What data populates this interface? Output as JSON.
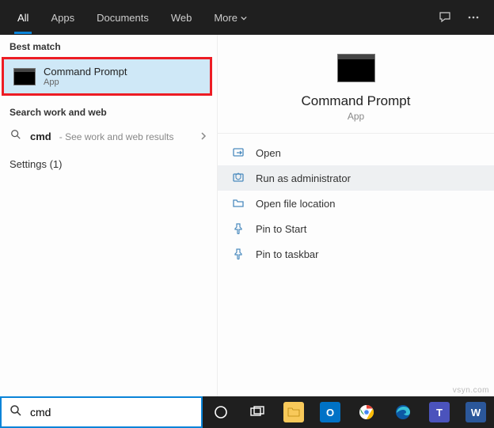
{
  "topbar": {
    "tabs": [
      {
        "label": "All",
        "active": true
      },
      {
        "label": "Apps",
        "active": false
      },
      {
        "label": "Documents",
        "active": false
      },
      {
        "label": "Web",
        "active": false
      },
      {
        "label": "More",
        "active": false,
        "dropdown": true
      }
    ]
  },
  "left": {
    "best_match_label": "Best match",
    "best_match": {
      "title": "Command Prompt",
      "subtitle": "App"
    },
    "search_web_label": "Search work and web",
    "search_web": {
      "query": "cmd",
      "hint": "- See work and web results"
    },
    "settings_row": "Settings (1)"
  },
  "preview": {
    "title": "Command Prompt",
    "subtitle": "App",
    "actions": [
      {
        "label": "Open",
        "icon": "open-icon",
        "selected": false
      },
      {
        "label": "Run as administrator",
        "icon": "admin-icon",
        "selected": true
      },
      {
        "label": "Open file location",
        "icon": "folder-icon",
        "selected": false
      },
      {
        "label": "Pin to Start",
        "icon": "pin-icon",
        "selected": false
      },
      {
        "label": "Pin to taskbar",
        "icon": "pin-icon",
        "selected": false
      }
    ]
  },
  "search": {
    "value": "cmd"
  },
  "taskbar_apps": [
    {
      "name": "cortana",
      "bg": "transparent"
    },
    {
      "name": "task-view",
      "bg": "transparent"
    },
    {
      "name": "file-explorer",
      "bg": "#f8c95a"
    },
    {
      "name": "outlook",
      "bg": "#0072c6"
    },
    {
      "name": "chrome",
      "bg": "transparent"
    },
    {
      "name": "edge",
      "bg": "transparent"
    },
    {
      "name": "teams",
      "bg": "#4b53bc"
    },
    {
      "name": "word",
      "bg": "#2b579a"
    }
  ],
  "watermark": "vsyn.com"
}
